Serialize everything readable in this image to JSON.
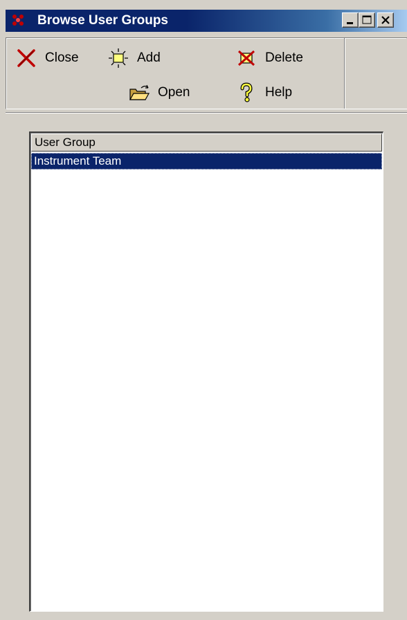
{
  "window": {
    "title": "Browse User Groups"
  },
  "toolbar": {
    "close_label": "Close",
    "add_label": "Add",
    "delete_label": "Delete",
    "open_label": "Open",
    "help_label": "Help"
  },
  "list": {
    "column_header": "User Group",
    "rows": [
      {
        "name": "Instrument Team",
        "selected": true
      }
    ]
  },
  "colors": {
    "title_active": "#0a246a",
    "selection": "#0a246a",
    "face": "#d4d0c8"
  }
}
